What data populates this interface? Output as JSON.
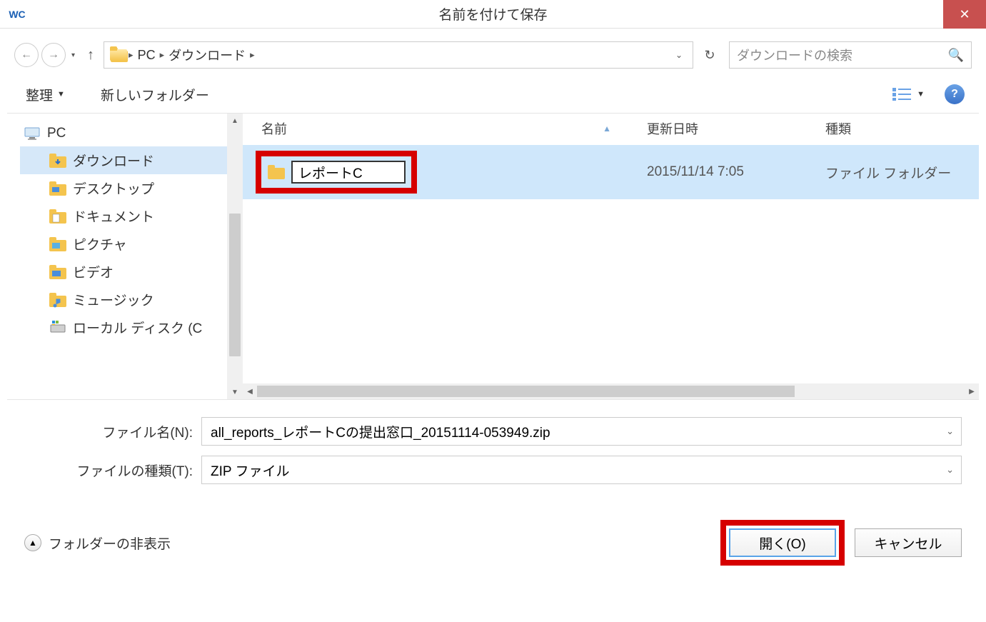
{
  "titlebar": {
    "app_icon_text": "WC",
    "title": "名前を付けて保存"
  },
  "breadcrumb": {
    "seg1": "PC",
    "seg2": "ダウンロード"
  },
  "search": {
    "placeholder": "ダウンロードの検索"
  },
  "toolbar": {
    "organize": "整理",
    "new_folder": "新しいフォルダー"
  },
  "columns": {
    "name": "名前",
    "date": "更新日時",
    "type": "種類"
  },
  "tree": {
    "pc": "PC",
    "items": [
      "ダウンロード",
      "デスクトップ",
      "ドキュメント",
      "ピクチャ",
      "ビデオ",
      "ミュージック",
      "ローカル ディスク (C"
    ]
  },
  "file_row": {
    "rename_value": "レポートC",
    "date": "2015/11/14 7:05",
    "type": "ファイル フォルダー"
  },
  "fields": {
    "filename_label": "ファイル名(N):",
    "filename_value": "all_reports_レポートCの提出窓口_20151114-053949.zip",
    "filetype_label": "ファイルの種類(T):",
    "filetype_value": "ZIP ファイル"
  },
  "footer": {
    "hide_folders": "フォルダーの非表示",
    "open": "開く(O)",
    "cancel": "キャンセル"
  }
}
